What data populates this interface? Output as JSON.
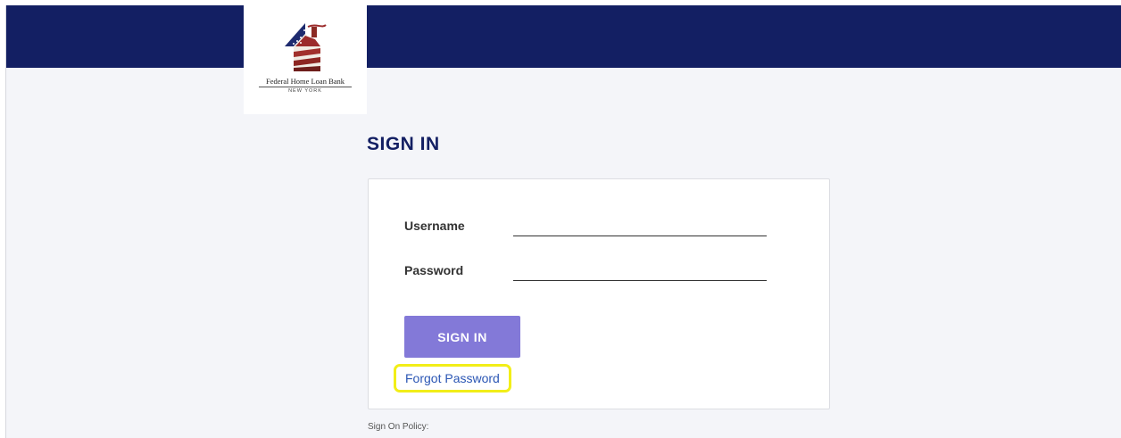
{
  "branding": {
    "logo_name": "Federal Home Loan Bank",
    "logo_sub": "NEW YORK",
    "header_color": "#131f63"
  },
  "page": {
    "title": "SIGN IN"
  },
  "form": {
    "username_label": "Username",
    "username_value": "",
    "password_label": "Password",
    "password_value": "",
    "submit_label": "SIGN IN",
    "submit_color": "#8379d8",
    "forgot_label": "Forgot Password",
    "forgot_highlight_color": "#f2ee18"
  },
  "footer": {
    "policy_label": "Sign On Policy:"
  }
}
